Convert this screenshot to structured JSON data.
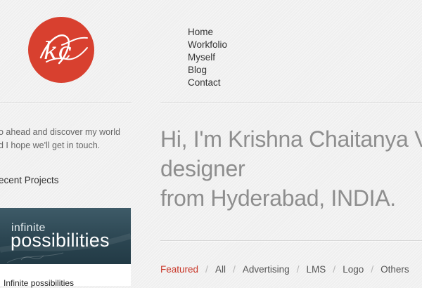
{
  "brand": {
    "logo_text": "kc",
    "logo_color": "#d8402f"
  },
  "nav": {
    "items": [
      "Home",
      "Workfolio",
      "Myself",
      "Blog",
      "Contact"
    ]
  },
  "sidebar": {
    "intro_line1": "o ahead and discover my world",
    "intro_line2": "d I hope we'll get in touch.",
    "recent_heading": "ecent Projects",
    "project": {
      "thumb_line1": "infinite",
      "thumb_line2": "possibilities",
      "title": "Infinite possibilities"
    }
  },
  "hero": {
    "line1": "Hi, I'm Krishna Chaitanya V",
    "line2": "designer",
    "line3": "from Hyderabad, INDIA."
  },
  "filters": {
    "separator": "/",
    "active_color": "#c9392b",
    "items": [
      "Featured",
      "All",
      "Advertising",
      "LMS",
      "Logo",
      "Others"
    ]
  }
}
